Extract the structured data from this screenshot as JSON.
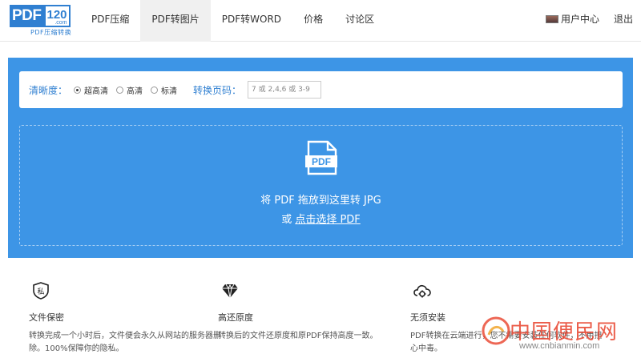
{
  "logo": {
    "main": "PDF",
    "number": "120",
    "domain": ".com",
    "subtitle": "PDF压缩转换"
  },
  "nav": {
    "items": [
      {
        "label": "PDF压缩"
      },
      {
        "label": "PDF转图片"
      },
      {
        "label": "PDF转WORD"
      },
      {
        "label": "价格"
      },
      {
        "label": "讨论区"
      }
    ],
    "active_index": 1
  },
  "user": {
    "center_label": "用户中心",
    "logout_label": "退出"
  },
  "options": {
    "clarity_label": "清晰度：",
    "clarity_options": [
      {
        "label": "超高清",
        "selected": true
      },
      {
        "label": "高清",
        "selected": false
      },
      {
        "label": "标清",
        "selected": false
      }
    ],
    "pages_label": "转换页码：",
    "pages_placeholder": "7 或 2,4,6 或 3-9"
  },
  "drop": {
    "icon_text": "PDF",
    "line1": "将 PDF 拖放到这里转 JPG",
    "line2_prefix": "或 ",
    "line2_link": "点击选择 PDF"
  },
  "features": [
    {
      "icon": "private-shield-icon",
      "icon_text": "私",
      "title": "文件保密",
      "desc": "转换完成一个小时后，文件便会永久从网站的服务器删除。100%保障你的隐私。"
    },
    {
      "icon": "diamond-icon",
      "title": "高还原度",
      "desc": "转换后的文件还原度和原PDF保持高度一致。"
    },
    {
      "icon": "cloud-gear-icon",
      "title": "无须安装",
      "desc": "PDF转换在云端进行，您不需要安装任何软件，不用担心中毒。"
    }
  ],
  "watermark": {
    "text": "中国便民网",
    "url": "www.cnbianmin.com"
  },
  "colors": {
    "brand": "#2f7fd1",
    "panel": "#3d95e6",
    "watermark": "#e8412b"
  }
}
